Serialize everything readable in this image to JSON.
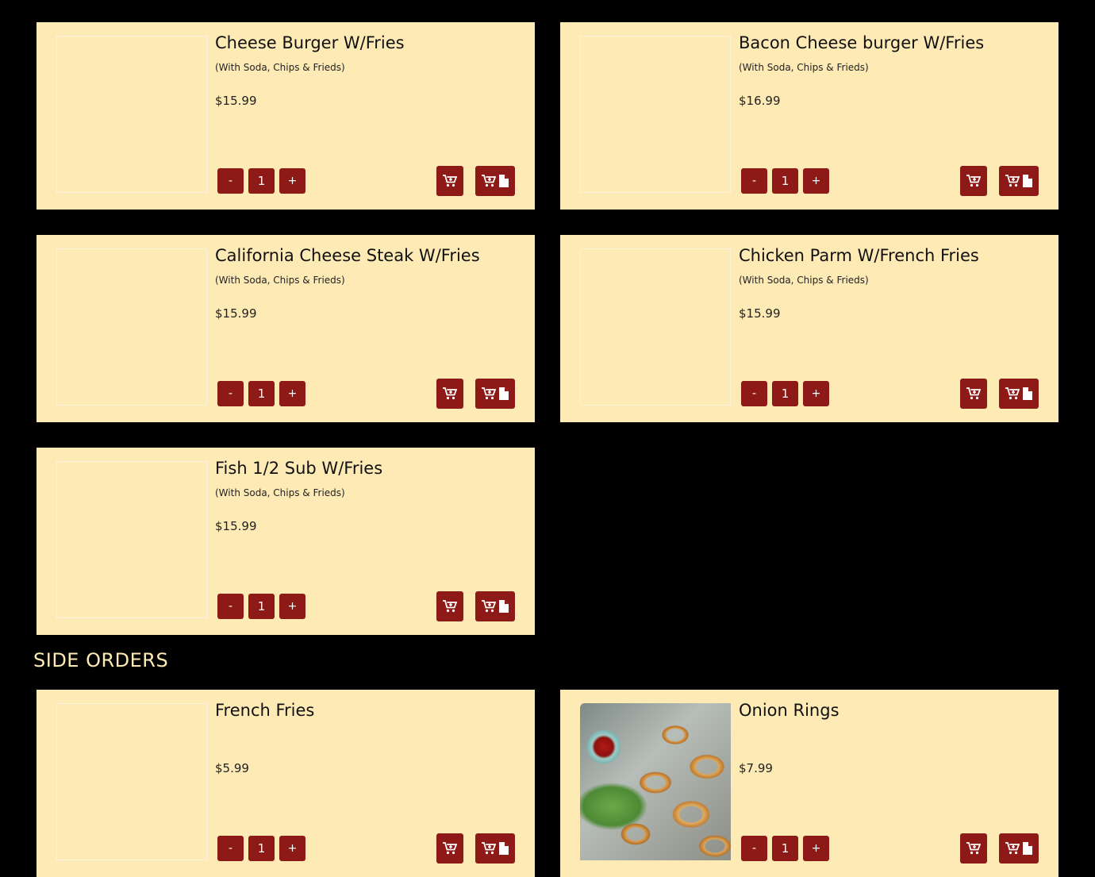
{
  "colors": {
    "background": "#000000",
    "card": "#feeab5",
    "button": "#8e1a17",
    "heading": "#feeab5"
  },
  "controls": {
    "minus_label": "-",
    "plus_label": "+",
    "cart_icon": "add-to-cart-icon",
    "detail_icons": [
      "add-to-cart-icon",
      "document-icon"
    ]
  },
  "main_items": [
    {
      "name": "Cheese Burger W/Fries",
      "description": "(With Soda, Chips & Frieds)",
      "price": "$15.99",
      "quantity": "1"
    },
    {
      "name": "Bacon Cheese burger W/Fries",
      "description": "(With Soda, Chips & Frieds)",
      "price": "$16.99",
      "quantity": "1"
    },
    {
      "name": "California Cheese Steak W/Fries",
      "description": "(With Soda, Chips & Frieds)",
      "price": "$15.99",
      "quantity": "1"
    },
    {
      "name": "Chicken Parm W/French Fries",
      "description": "(With Soda, Chips & Frieds)",
      "price": "$15.99",
      "quantity": "1"
    },
    {
      "name": "Fish 1/2 Sub W/Fries",
      "description": "(With Soda, Chips & Frieds)",
      "price": "$15.99",
      "quantity": "1"
    }
  ],
  "side_orders": {
    "heading": "SIDE ORDERS",
    "items": [
      {
        "name": "French Fries",
        "price": "$5.99",
        "quantity": "1"
      },
      {
        "name": "Onion Rings",
        "price": "$7.99",
        "quantity": "1"
      }
    ]
  }
}
